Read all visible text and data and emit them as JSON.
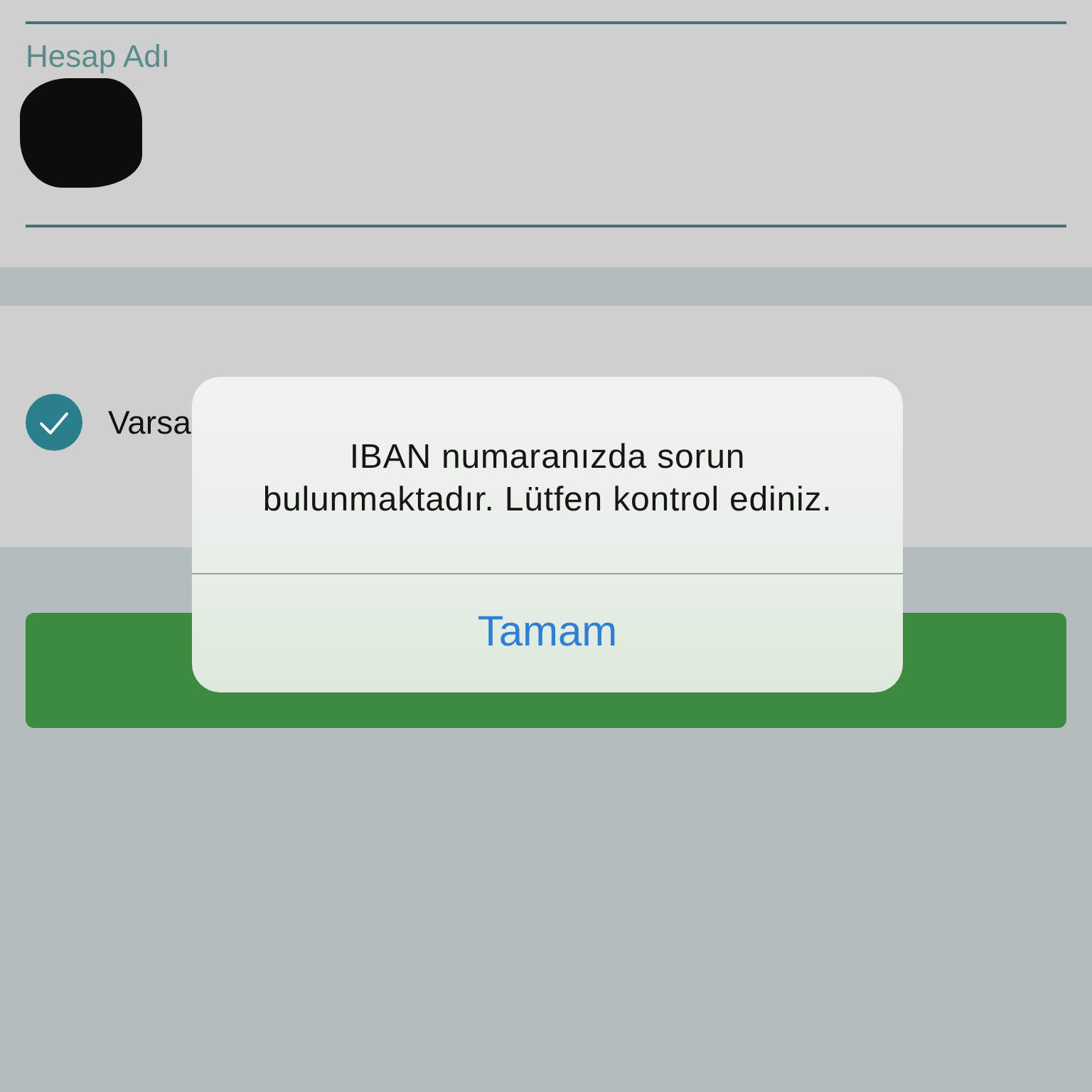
{
  "form": {
    "field": {
      "label": "Hesap Adı",
      "value_redacted": true
    },
    "checkbox": {
      "label": "Varsa",
      "checked": true
    }
  },
  "alert": {
    "message": "IBAN numaranızda sorun\nbulunmaktadır. Lütfen kontrol ediniz.",
    "buttons": [
      {
        "label": "Tamam"
      }
    ]
  }
}
